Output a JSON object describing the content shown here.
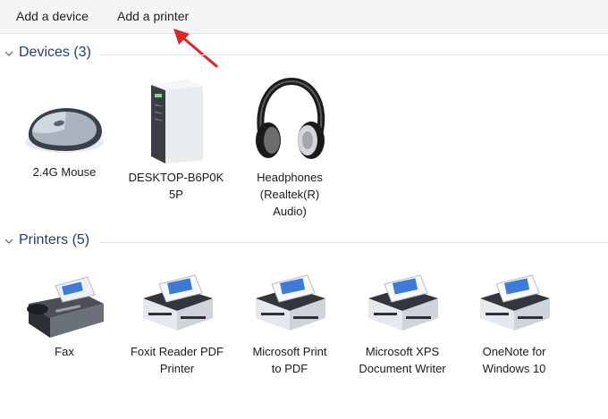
{
  "toolbar": {
    "add_device": "Add a device",
    "add_printer": "Add a printer"
  },
  "groups": {
    "devices": {
      "title": "Devices (3)",
      "items": [
        {
          "label": "2.4G Mouse",
          "icon": "mouse-icon"
        },
        {
          "label": "DESKTOP-B6P0K\n5P",
          "icon": "computer-tower-icon"
        },
        {
          "label": "Headphones\n(Realtek(R)\nAudio)",
          "icon": "headphones-icon"
        }
      ]
    },
    "printers": {
      "title": "Printers (5)",
      "items": [
        {
          "label": "Fax",
          "icon": "fax-icon"
        },
        {
          "label": "Foxit Reader PDF\nPrinter",
          "icon": "printer-icon"
        },
        {
          "label": "Microsoft Print\nto PDF",
          "icon": "printer-icon"
        },
        {
          "label": "Microsoft XPS\nDocument Writer",
          "icon": "printer-icon"
        },
        {
          "label": "OneNote for\nWindows 10",
          "icon": "printer-icon"
        }
      ]
    }
  },
  "colors": {
    "header_text": "#1f3f6e",
    "annotation_arrow": "#e02424",
    "toolbar_bg": "#f4f5f6"
  }
}
